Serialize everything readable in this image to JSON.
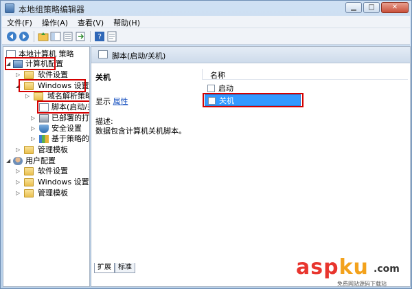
{
  "window": {
    "title": "本地组策略编辑器",
    "controls": {
      "minimize": "▁",
      "maximize": "□",
      "close": "✕"
    }
  },
  "menubar": {
    "items": [
      "文件(F)",
      "操作(A)",
      "查看(V)",
      "帮助(H)"
    ]
  },
  "toolbar": {
    "icons": [
      "back-arrow-icon",
      "forward-arrow-icon",
      "up-folder-icon",
      "show-hide-tree-icon",
      "export-list-icon",
      "refresh-icon",
      "help-icon",
      "properties-icon"
    ]
  },
  "tree": {
    "root": "本地计算机 策略",
    "computer_config": "计算机配置",
    "software_settings": "软件设置",
    "windows_settings": "Windows 设置",
    "name_resolution_policy": "域名解析策略",
    "scripts": "脚本(启动/关机)",
    "deployed_printers": "已部署的打印",
    "security_settings": "安全设置",
    "qos": "基于策略的 Q",
    "admin_templates": "管理模板",
    "user_config": "用户配置",
    "user_software_settings": "软件设置",
    "user_windows_settings": "Windows 设置",
    "user_admin_templates": "管理模板"
  },
  "right_pane": {
    "header_title": "脚本(启动/关机)",
    "section_title": "关机",
    "show_label": "显示",
    "properties_link": "属性",
    "description_label": "描述:",
    "description_text": "数据包含计算机关机脚本。",
    "column_name": "名称",
    "items": [
      {
        "label": "启动",
        "selected": false
      },
      {
        "label": "关机",
        "selected": true
      }
    ],
    "tabs": [
      "扩展",
      "标准"
    ]
  },
  "watermark": {
    "asp": "asp",
    "ku": "ku",
    "com": ".com",
    "subtitle": "免费网站源码下载站"
  },
  "colors": {
    "highlight_box": "#d40000",
    "selection": "#3399ff",
    "link": "#1a53c0"
  }
}
